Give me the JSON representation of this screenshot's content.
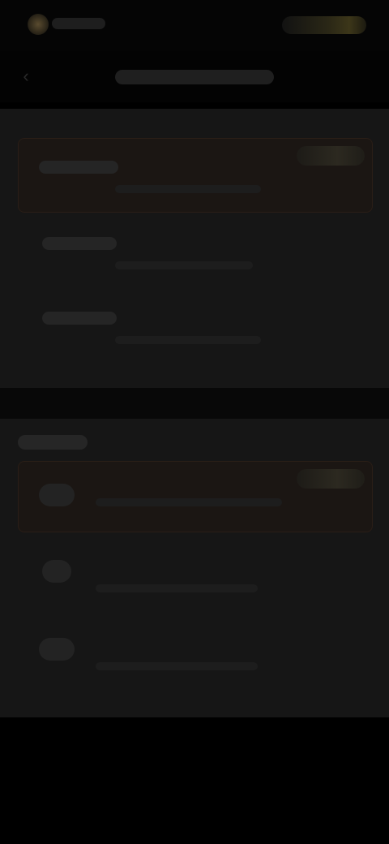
{
  "app": {
    "brand_name": "",
    "top_action_label": ""
  },
  "header": {
    "title": ""
  },
  "card1": {
    "rows": [
      {
        "title": "",
        "subtitle": "",
        "badge": ""
      },
      {
        "title": "",
        "subtitle": ""
      },
      {
        "title": "",
        "subtitle": ""
      }
    ]
  },
  "card2": {
    "section_label": "",
    "rows": [
      {
        "title": "",
        "subtitle": "",
        "badge": ""
      },
      {
        "title": "",
        "subtitle": ""
      },
      {
        "title": "",
        "subtitle": ""
      }
    ]
  },
  "colors": {
    "background": "#000000",
    "card": "#161616",
    "accent": "#3c3619",
    "highlight_row": "#1b1613"
  },
  "icons": {
    "back": "arrow-left-icon",
    "logo": "brand-logo-icon"
  }
}
